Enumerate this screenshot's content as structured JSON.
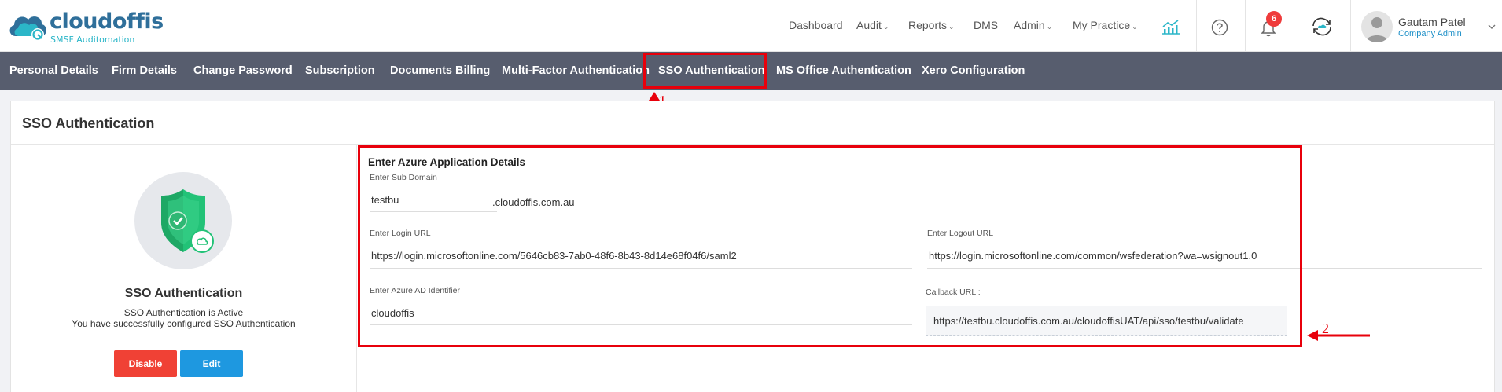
{
  "brand": {
    "name": "cloudoffis",
    "tagline": "SMSF Auditomation"
  },
  "top_nav": {
    "items": [
      {
        "label": "Dashboard",
        "dropdown": false
      },
      {
        "label": "Audit",
        "dropdown": true
      },
      {
        "label": "Reports",
        "dropdown": true
      },
      {
        "label": "DMS",
        "dropdown": false
      },
      {
        "label": "Admin",
        "dropdown": true
      },
      {
        "label": "My Practice",
        "dropdown": true
      }
    ],
    "chevron": "⌄",
    "notification_count": "6"
  },
  "user": {
    "name": "Gautam Patel",
    "role": "Company Admin"
  },
  "tabs": [
    {
      "label": "Personal Details"
    },
    {
      "label": "Firm Details"
    },
    {
      "label": "Change Password"
    },
    {
      "label": "Subscription"
    },
    {
      "label": "Documents Billing"
    },
    {
      "label": "Multi-Factor Authentication"
    },
    {
      "label": "SSO Authentication",
      "active": true
    },
    {
      "label": "MS Office Authentication"
    },
    {
      "label": "Xero Configuration"
    }
  ],
  "annotations": {
    "one": "1",
    "two": "2"
  },
  "page": {
    "title": "SSO Authentication"
  },
  "status_panel": {
    "title": "SSO Authentication",
    "line1": "SSO Authentication is Active",
    "line2": "You have successfully configured SSO Authentication",
    "disable_label": "Disable",
    "edit_label": "Edit"
  },
  "form": {
    "heading": "Enter Azure Application Details",
    "sub_domain": {
      "label": "Enter Sub Domain",
      "value": "testbu",
      "suffix": ".cloudoffis.com.au"
    },
    "login_url": {
      "label": "Enter Login URL",
      "value": "https://login.microsoftonline.com/5646cb83-7ab0-48f6-8b43-8d14e68f04f6/saml2"
    },
    "logout_url": {
      "label": "Enter Logout URL",
      "value": "https://login.microsoftonline.com/common/wsfederation?wa=wsignout1.0"
    },
    "azure_ad": {
      "label": "Enter Azure AD Identifier",
      "value": "cloudoffis"
    },
    "callback": {
      "label": "Callback URL :",
      "value": "https://testbu.cloudoffis.com.au/cloudoffisUAT/api/sso/testbu/validate"
    }
  },
  "colors": {
    "accent": "#1e98e0",
    "danger": "#f04135",
    "tabs_bg": "#575d6e",
    "annotation": "#e8000b",
    "shield": "#22c277"
  }
}
